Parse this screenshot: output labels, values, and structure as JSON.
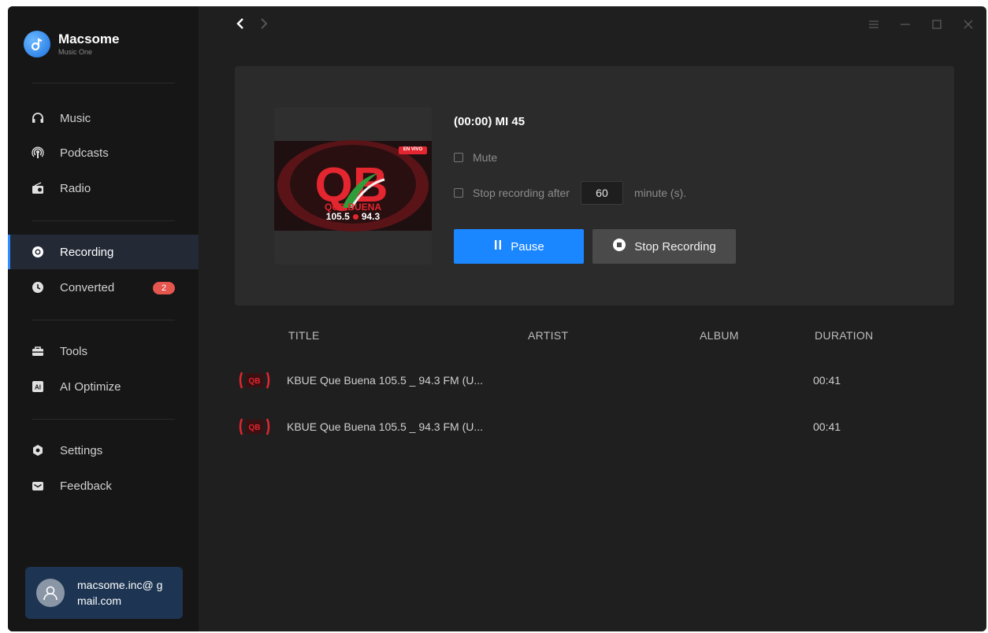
{
  "app": {
    "name": "Macsome",
    "subtitle": "Music One"
  },
  "sidebar": {
    "groups": [
      [
        {
          "label": "Music",
          "icon": "headphones-icon"
        },
        {
          "label": "Podcasts",
          "icon": "podcast-icon"
        },
        {
          "label": "Radio",
          "icon": "radio-icon"
        }
      ],
      [
        {
          "label": "Recording",
          "icon": "record-icon",
          "active": true
        },
        {
          "label": "Converted",
          "icon": "clock-icon",
          "badge": "2"
        }
      ],
      [
        {
          "label": "Tools",
          "icon": "toolbox-icon"
        },
        {
          "label": "AI Optimize",
          "icon": "ai-icon"
        }
      ],
      [
        {
          "label": "Settings",
          "icon": "gear-icon"
        },
        {
          "label": "Feedback",
          "icon": "mail-icon"
        }
      ]
    ],
    "account_email": "macsome.inc@ gmail.com"
  },
  "now_recording": {
    "title": "(00:00) MI 45",
    "mute_label": "Mute",
    "stop_after_label": "Stop recording after",
    "stop_after_minutes": "60",
    "minute_unit": "minute (s).",
    "pause_label": "Pause",
    "stop_label": "Stop Recording",
    "cover": {
      "text_que_buena": "QUE BUENA",
      "freq_left": "105.5",
      "freq_right": "94.3",
      "live_tag": "EN VIVO"
    }
  },
  "table": {
    "columns": [
      "TITLE",
      "ARTIST",
      "ALBUM",
      "DURATION"
    ],
    "rows": [
      {
        "title": "KBUE Que Buena 105.5 _ 94.3 FM (U...",
        "artist": "",
        "album": "",
        "duration": "00:41"
      },
      {
        "title": "KBUE Que Buena 105.5 _ 94.3 FM (U...",
        "artist": "",
        "album": "",
        "duration": "00:41"
      }
    ]
  },
  "colors": {
    "accent": "#1a86ff",
    "badge": "#e4564e",
    "background": "#1f1f1f",
    "sidebar": "#161616"
  }
}
